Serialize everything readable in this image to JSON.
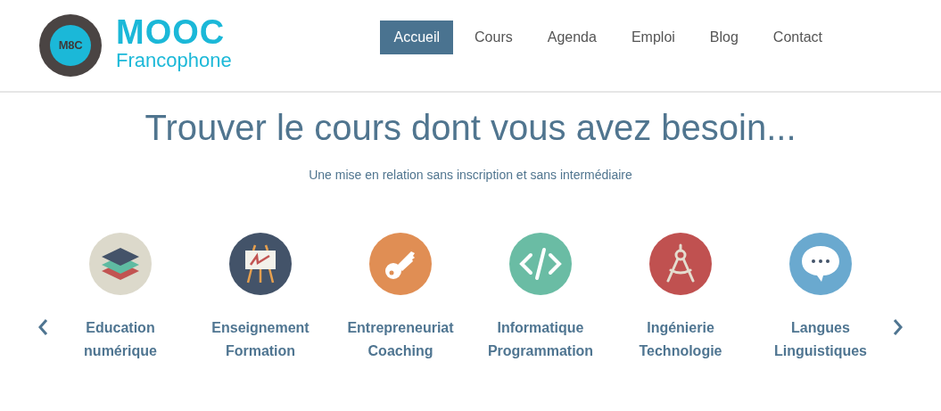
{
  "logo": {
    "badge": "M8C",
    "title": "MOOC",
    "subtitle": "Francophone"
  },
  "nav": [
    {
      "label": "Accueil",
      "selected": true
    },
    {
      "label": "Cours",
      "selected": false
    },
    {
      "label": "Agenda",
      "selected": false
    },
    {
      "label": "Emploi",
      "selected": false
    },
    {
      "label": "Blog",
      "selected": false
    },
    {
      "label": "Contact",
      "selected": false
    }
  ],
  "heading": "Trouver le cours dont vous avez besoin...",
  "subheading": "Une mise en relation sans inscription et sans intermédiaire",
  "categories": [
    {
      "kind": "layers",
      "color": "#dcd9cb",
      "lines": [
        "Education",
        "numérique"
      ]
    },
    {
      "kind": "easel",
      "color": "#435369",
      "lines": [
        "Enseignement",
        "Formation"
      ]
    },
    {
      "kind": "key",
      "color": "#e08e54",
      "lines": [
        "Entrepreneuriat",
        "Coaching"
      ]
    },
    {
      "kind": "code",
      "color": "#6abca4",
      "lines": [
        "Informatique",
        "Programmation"
      ]
    },
    {
      "kind": "compass",
      "color": "#c05150",
      "lines": [
        "Ingénierie",
        "Technologie"
      ]
    },
    {
      "kind": "chat",
      "color": "#6aa9cf",
      "lines": [
        "Langues",
        "Linguistiques"
      ]
    }
  ]
}
